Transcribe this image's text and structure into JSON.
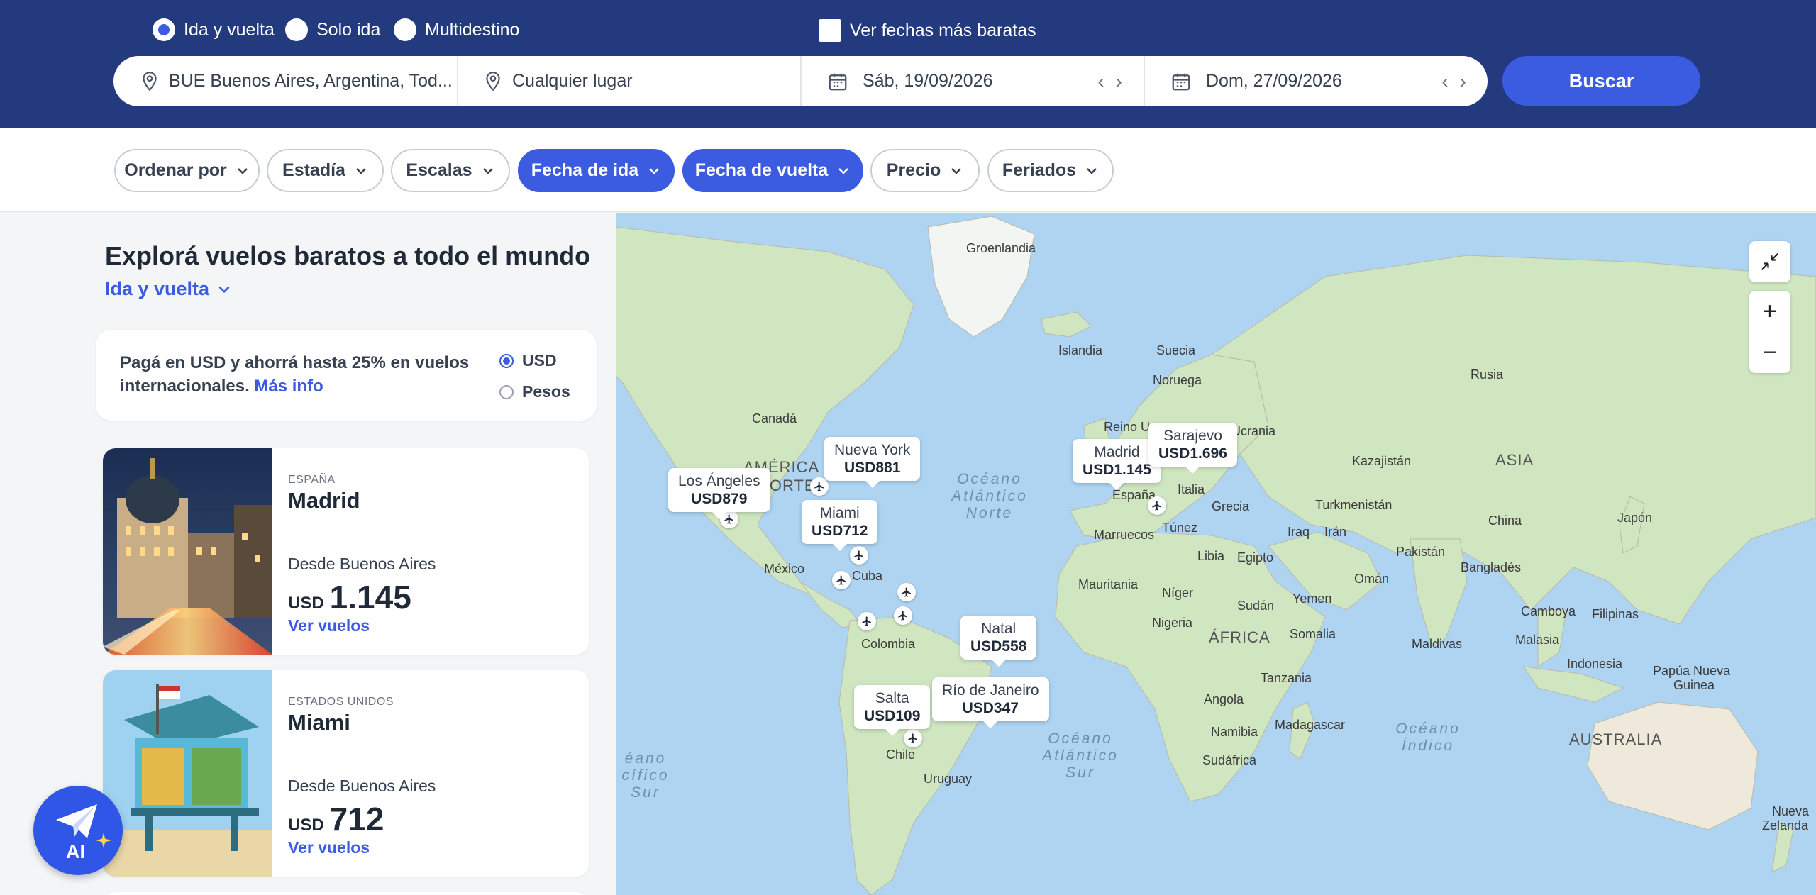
{
  "trip_types": [
    {
      "label": "Ida y vuelta",
      "selected": true
    },
    {
      "label": "Solo ida",
      "selected": false
    },
    {
      "label": "Multidestino",
      "selected": false
    }
  ],
  "cheapest_dates": {
    "label": "Ver fechas más baratas",
    "checked": false
  },
  "search": {
    "origin": "BUE Buenos Aires, Argentina, Tod...",
    "destination": "Cualquier lugar",
    "depart_date": "Sáb, 19/09/2026",
    "return_date": "Dom, 27/09/2026",
    "button": "Buscar"
  },
  "filters": [
    {
      "label": "Ordenar por",
      "active": false
    },
    {
      "label": "Estadía",
      "active": false
    },
    {
      "label": "Escalas",
      "active": false
    },
    {
      "label": "Fecha de ida",
      "active": true
    },
    {
      "label": "Fecha de vuelta",
      "active": true
    },
    {
      "label": "Precio",
      "active": false
    },
    {
      "label": "Feriados",
      "active": false
    }
  ],
  "panel": {
    "title": "Explorá vuelos baratos a todo el mundo",
    "trip_dropdown": "Ida y vuelta",
    "promo": {
      "text": "Pagá en USD y ahorrá hasta 25% en vuelos internacionales.",
      "link": "Más info",
      "options": [
        {
          "label": "USD",
          "selected": true
        },
        {
          "label": "Pesos",
          "selected": false
        }
      ]
    },
    "cards": [
      {
        "country": "ESPAÑA",
        "city": "Madrid",
        "from": "Desde Buenos Aires",
        "currency": "USD",
        "price": "1.145",
        "link": "Ver vuelos"
      },
      {
        "country": "ESTADOS UNIDOS",
        "city": "Miami",
        "from": "Desde Buenos Aires",
        "currency": "USD",
        "price": "712",
        "link": "Ver vuelos"
      }
    ]
  },
  "ai_button": "AI",
  "map": {
    "pins": [
      {
        "name": "Los Ángeles",
        "price": "USD879"
      },
      {
        "name": "Nueva York",
        "price": "USD881"
      },
      {
        "name": "Miami",
        "price": "USD712"
      },
      {
        "name": "Madrid",
        "price": "USD1.145"
      },
      {
        "name": "Sarajevo",
        "price": "USD1.696"
      },
      {
        "name": "Natal",
        "price": "USD558"
      },
      {
        "name": "Salta",
        "price": "USD109"
      },
      {
        "name": "Río de Janeiro",
        "price": "USD347"
      }
    ],
    "labels": [
      "Groenlandia",
      "Islandia",
      "Suecia",
      "Noruega",
      "Rusia",
      "Canadá",
      "AMÉRICA",
      "NORTE",
      "Reino U",
      "Ucrania",
      "Kazajistán",
      "ASIA",
      "España",
      "Italia",
      "Grecia",
      "Turkmenistán",
      "China",
      "Japón",
      "Marruecos",
      "Túnez",
      "Iraq",
      "Irán",
      "Libia",
      "Egipto",
      "Pakistán",
      "Bangladés",
      "Omán",
      "México",
      "Cuba",
      "Mauritania",
      "Níger",
      "Sudán",
      "Yemen",
      "Nigeria",
      "ÁFRICA",
      "Somalia",
      "Maldivas",
      "Camboya",
      "Filipinas",
      "Malasia",
      "Indonesia",
      "Papúa Nueva",
      "Guinea",
      "Colombia",
      "Tanzania",
      "Angola",
      "Namibia",
      "Madagascar",
      "Sudáfrica",
      "Chile",
      "Uruguay",
      "AUSTRALIA",
      "Nueva",
      "Zelanda"
    ],
    "oceans": [
      "Océano Atlántico Norte",
      "Océano Atlántico Sur",
      "Océano Índico",
      "éano cífico Sur"
    ]
  }
}
